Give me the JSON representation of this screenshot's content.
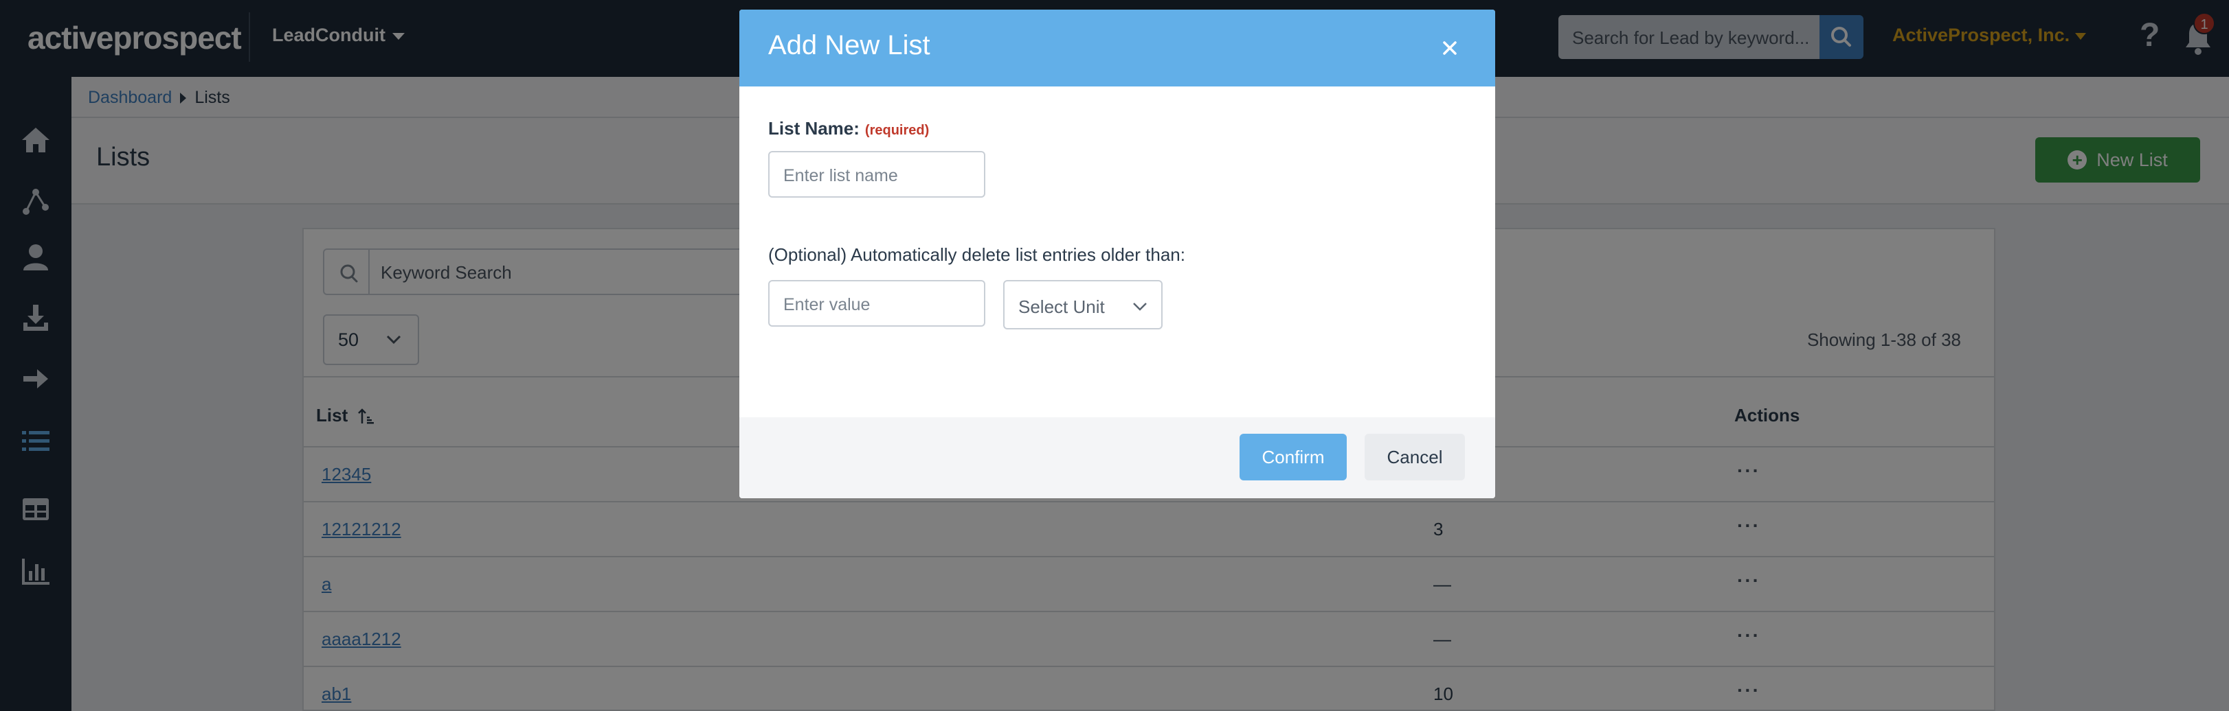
{
  "topbar": {
    "logo": "activeprospect",
    "product": "LeadConduit",
    "search_placeholder": "Search for Lead by keyword...",
    "account": "ActiveProspect, Inc.",
    "help": "?",
    "notifications_count": "1"
  },
  "sidenav": {
    "items": [
      "home-icon",
      "flows-icon",
      "user-icon",
      "download-icon",
      "arrow-right-icon",
      "list-icon",
      "table-icon",
      "chart-icon"
    ],
    "active": "list-icon"
  },
  "breadcrumb": {
    "home": "Dashboard",
    "current": "Lists"
  },
  "page": {
    "title": "Lists",
    "new_list_label": "New List"
  },
  "panel": {
    "keyword_placeholder": "Keyword Search",
    "per_page": "50",
    "showing": "Showing 1-38 of 38",
    "columns": {
      "list": "List",
      "actions": "Actions"
    },
    "rows": [
      {
        "name": "12345",
        "count": ""
      },
      {
        "name": "12121212",
        "count": "3"
      },
      {
        "name": "a",
        "count": "—"
      },
      {
        "name": "aaaa1212",
        "count": "—"
      },
      {
        "name": "ab1",
        "count": "10"
      }
    ],
    "row_actions": "···"
  },
  "modal": {
    "title": "Add New List",
    "name_label": "List Name:",
    "required": "(required)",
    "name_placeholder": "Enter list name",
    "optional_label": "(Optional) Automatically delete list entries older than:",
    "value_placeholder": "Enter value",
    "unit_placeholder": "Select Unit",
    "confirm": "Confirm",
    "cancel": "Cancel"
  },
  "colors": {
    "topbar": "#1f2a38",
    "modal_header": "#62afe8",
    "new_list_button": "#3a9a48",
    "account": "#d9a21c",
    "link": "#3f7fbf"
  }
}
